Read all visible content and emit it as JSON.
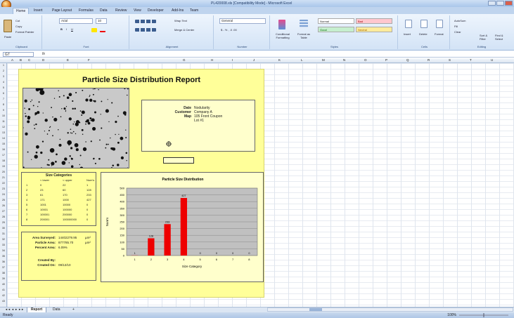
{
  "window": {
    "title": "PL420008.xls [Compatibility Mode] - Microsoft Excel"
  },
  "ribbon": {
    "tabs": [
      "Home",
      "Insert",
      "Page Layout",
      "Formulas",
      "Data",
      "Review",
      "View",
      "Developer",
      "Add-Ins",
      "Team"
    ],
    "clipboard": {
      "cut": "Cut",
      "copy": "Copy",
      "paste": "Paste",
      "format_painter": "Format Painter",
      "label": "Clipboard"
    },
    "font": {
      "name": "Arial",
      "size": "10",
      "label": "Font"
    },
    "alignment": {
      "wrap": "Wrap Text",
      "merge": "Merge & Center",
      "label": "Alignment"
    },
    "number": {
      "format": "General",
      "label": "Number"
    },
    "styles": {
      "conditional": "Conditional Formatting",
      "format_table": "Format as Table",
      "normal": "Normal",
      "bad": "Bad",
      "good": "Good",
      "neutral": "Neutral",
      "label": "Styles"
    },
    "cells": {
      "insert": "Insert",
      "delete": "Delete",
      "format": "Format",
      "label": "Cells"
    },
    "editing": {
      "autosum": "AutoSum",
      "fill": "Fill",
      "clear": "Clear",
      "sort": "Sort & Filter",
      "find": "Find & Select",
      "label": "Editing"
    }
  },
  "formula_bar": {
    "name_box": "G7",
    "fx": "fx",
    "value": ""
  },
  "columns": [
    "A",
    "B",
    "C",
    "D",
    "E",
    "F",
    "G",
    "H",
    "I",
    "J",
    "K",
    "L",
    "M",
    "N",
    "O",
    "P",
    "Q",
    "R",
    "S",
    "T",
    "U",
    "V",
    "W",
    "X",
    "Y",
    "Z"
  ],
  "report": {
    "title": "Particle Size Distribution Report",
    "info": [
      {
        "label": "Date",
        "value": "Nodularity"
      },
      {
        "label": "Customer",
        "value": "Company A"
      },
      {
        "label": "Map",
        "value": "105 Front Coupon"
      },
      {
        "label": "",
        "value": "Lot #1"
      }
    ],
    "size_categories": {
      "title": "Size Categories",
      "headers": [
        "",
        "< lower",
        "< upper",
        "Num's"
      ],
      "rows": [
        [
          "1",
          "0",
          "22",
          "1"
        ],
        [
          "2",
          "23",
          "60",
          "128"
        ],
        [
          "3",
          "61",
          "170",
          "233"
        ],
        [
          "4",
          "171",
          "1000",
          "427"
        ],
        [
          "5",
          "1001",
          "10000",
          "0"
        ],
        [
          "6",
          "10001",
          "100000",
          "0"
        ],
        [
          "7",
          "100001",
          "200000",
          "0"
        ],
        [
          "8",
          "200001",
          "100000000",
          "0"
        ]
      ]
    },
    "survey": [
      {
        "label": "Area Surveyed:",
        "value": "14402279.95",
        "unit": "µm²"
      },
      {
        "label": "Particle Area:",
        "value": "877785.70",
        "unit": "µm²"
      },
      {
        "label": "Percent Area:",
        "value": "6.09%",
        "unit": ""
      },
      {
        "label": "Created By:",
        "value": "",
        "unit": ""
      },
      {
        "label": "Created On:",
        "value": "09/12/10",
        "unit": ""
      }
    ]
  },
  "chart_data": {
    "type": "bar",
    "title": "Particle Size Distribution",
    "xlabel": "Size Category",
    "ylabel": "Num's",
    "categories": [
      "1",
      "2",
      "3",
      "4",
      "5",
      "6",
      "7",
      "8"
    ],
    "values": [
      1,
      128,
      233,
      427,
      0,
      0,
      0,
      0
    ],
    "data_labels": [
      "1",
      "128",
      "233",
      "427",
      "0",
      "0",
      "0",
      "0"
    ],
    "ylim": [
      0,
      500
    ],
    "yticks": [
      "0",
      "50",
      "100",
      "150",
      "200",
      "250",
      "300",
      "350",
      "400",
      "450",
      "500"
    ],
    "bar_color": "#ee0000",
    "plot_bg": "#c0c0c0",
    "grid": true
  },
  "sheets": {
    "tabs": [
      "Report",
      "Data"
    ],
    "active": "Report"
  },
  "status": {
    "text": "Ready",
    "zoom": "100%"
  },
  "colors": {
    "report_bg": "#ffff99",
    "titlebar": "#a9c6ea"
  }
}
